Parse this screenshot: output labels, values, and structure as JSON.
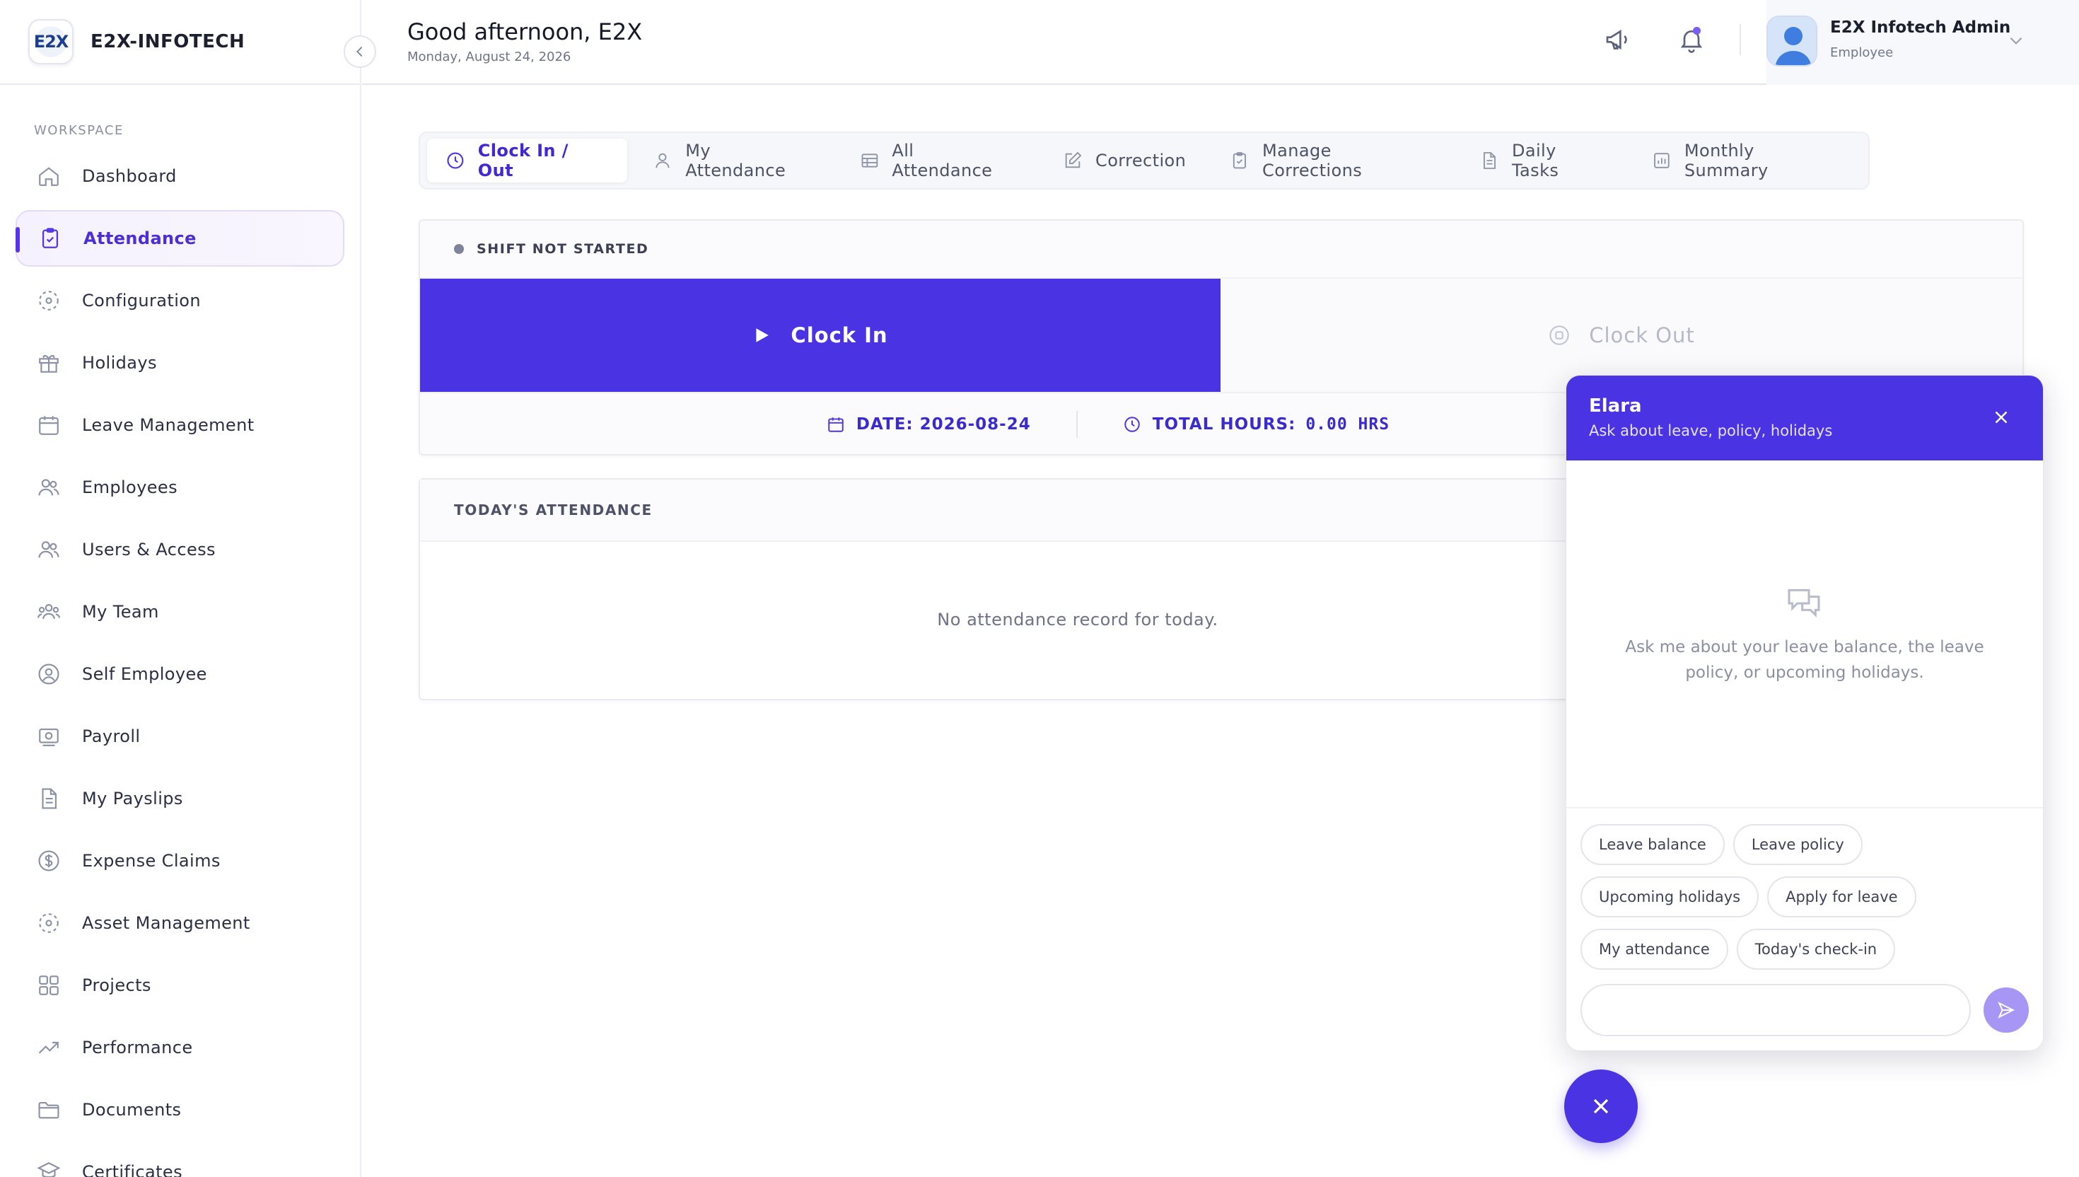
{
  "brand": {
    "logo_text": "E2X",
    "name": "E2X-INFOTECH"
  },
  "sidebar": {
    "section_label": "WORKSPACE",
    "items": [
      {
        "label": "Dashboard",
        "icon": "home-icon"
      },
      {
        "label": "Attendance",
        "icon": "clipboard-icon",
        "active": true
      },
      {
        "label": "Configuration",
        "icon": "settings-dashed-icon"
      },
      {
        "label": "Holidays",
        "icon": "gift-icon"
      },
      {
        "label": "Leave Management",
        "icon": "calendar-icon"
      },
      {
        "label": "Employees",
        "icon": "users-icon"
      },
      {
        "label": "Users & Access",
        "icon": "users-access-icon"
      },
      {
        "label": "My Team",
        "icon": "team-icon"
      },
      {
        "label": "Self Employee",
        "icon": "user-circle-icon"
      },
      {
        "label": "Payroll",
        "icon": "payroll-icon"
      },
      {
        "label": "My Payslips",
        "icon": "document-icon"
      },
      {
        "label": "Expense Claims",
        "icon": "dollar-circle-icon"
      },
      {
        "label": "Asset Management",
        "icon": "asset-icon"
      },
      {
        "label": "Projects",
        "icon": "grid-icon"
      },
      {
        "label": "Performance",
        "icon": "trend-up-icon"
      },
      {
        "label": "Documents",
        "icon": "folder-icon"
      },
      {
        "label": "Certificates",
        "icon": "certificate-icon"
      }
    ]
  },
  "header": {
    "greeting": "Good afternoon, E2X",
    "date": "Monday, August 24, 2026",
    "user_name": "E2X Infotech Admin",
    "user_role": "Employee"
  },
  "tabs": [
    {
      "label": "Clock In / Out",
      "icon": "clock-icon",
      "active": true
    },
    {
      "label": "My Attendance",
      "icon": "user-icon"
    },
    {
      "label": "All Attendance",
      "icon": "table-icon"
    },
    {
      "label": "Correction",
      "icon": "edit-icon"
    },
    {
      "label": "Manage Corrections",
      "icon": "clipboard-check-icon"
    },
    {
      "label": "Daily Tasks",
      "icon": "file-icon"
    },
    {
      "label": "Monthly Summary",
      "icon": "chart-icon"
    }
  ],
  "clock": {
    "status": "SHIFT NOT STARTED",
    "clock_in_label": "Clock In",
    "clock_out_label": "Clock Out",
    "date_label": "DATE: 2026-08-24",
    "total_hours_label": "TOTAL HOURS:",
    "total_hours_value": "0.00 HRS"
  },
  "attendance": {
    "title": "TODAY'S ATTENDANCE",
    "empty_text": "No attendance record for today."
  },
  "chat": {
    "title": "Elara",
    "subtitle": "Ask about leave, policy, holidays",
    "empty_text": "Ask me about your leave balance, the leave policy, or upcoming holidays.",
    "chips": [
      [
        "Leave balance",
        "Leave policy"
      ],
      [
        "Upcoming holidays",
        "Apply for leave"
      ],
      [
        "My attendance",
        "Today's check-in"
      ]
    ],
    "input_value": "",
    "input_placeholder": ""
  },
  "colors": {
    "accent": "#4a33e3",
    "accent_light": "#a896f4",
    "sidebar_active_bg": "#f5f1fe"
  }
}
